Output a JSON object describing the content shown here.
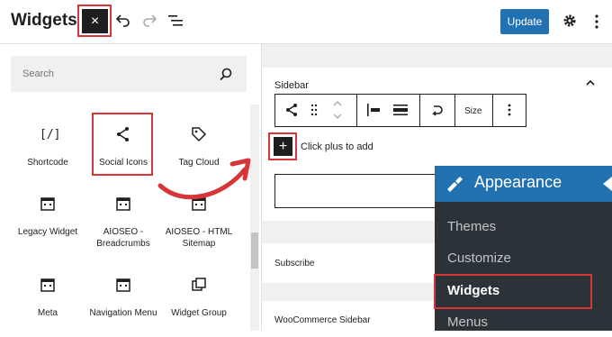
{
  "header": {
    "title": "Widgets",
    "close_glyph": "×",
    "update_label": "Update",
    "icons": [
      "undo-icon",
      "redo-icon",
      "list-view-icon",
      "gear-icon",
      "more-vertical-icon"
    ]
  },
  "inserter": {
    "search_placeholder": "Search",
    "blocks": [
      {
        "label": "Shortcode",
        "icon": "shortcode-icon"
      },
      {
        "label": "Social Icons",
        "icon": "share-icon"
      },
      {
        "label": "Tag Cloud",
        "icon": "tag-icon"
      },
      {
        "label": "Legacy Widget",
        "icon": "calendar-icon"
      },
      {
        "label": "AIOSEO - Breadcrumbs",
        "icon": "calendar-icon"
      },
      {
        "label": "AIOSEO - HTML Sitemap",
        "icon": "calendar-icon"
      },
      {
        "label": "Meta",
        "icon": "calendar-icon"
      },
      {
        "label": "Navigation Menu",
        "icon": "calendar-icon"
      },
      {
        "label": "Widget Group",
        "icon": "group-icon"
      }
    ],
    "shortcode_glyph": "[/]"
  },
  "editor": {
    "sidebar_label": "Sidebar",
    "toolbar_size_label": "Size",
    "plus_glyph": "+",
    "plus_hint": "Click plus to add",
    "areas": [
      "Subscribe",
      "WooCommerce Sidebar"
    ]
  },
  "appearance_menu": {
    "title": "Appearance",
    "items": [
      "Themes",
      "Customize",
      "Widgets",
      "Menus"
    ],
    "selected": "Widgets"
  },
  "colors": {
    "accent": "#2271b1",
    "highlight": "#d63638",
    "admin_menu": "#2c3338",
    "dark": "#1e1e1e"
  }
}
